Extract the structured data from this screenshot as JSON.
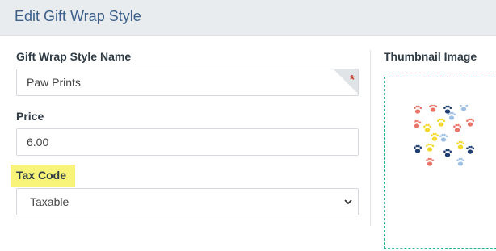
{
  "header": {
    "title": "Edit Gift Wrap Style"
  },
  "form": {
    "name": {
      "label": "Gift Wrap Style Name",
      "value": "Paw Prints",
      "required_mark": "*"
    },
    "price": {
      "label": "Price",
      "value": "6.00"
    },
    "tax_code": {
      "label": "Tax Code",
      "value": "Taxable"
    }
  },
  "thumbnail": {
    "label": "Thumbnail Image"
  },
  "colors": {
    "header_text": "#3b5f8a",
    "highlight": "#f8f47a",
    "dashed_border": "#2bb59a",
    "paw_red": "#e8746a",
    "paw_yellow": "#f2d92c",
    "paw_navy": "#1f3f73",
    "paw_lightblue": "#9fc1e6"
  }
}
